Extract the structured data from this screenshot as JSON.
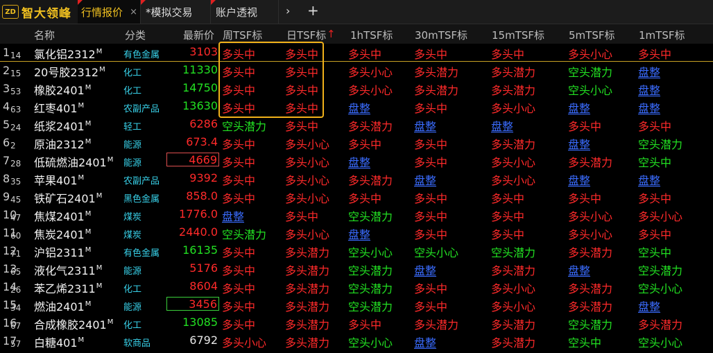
{
  "app": {
    "logo_mark": "ZD",
    "logo_text": "智大领峰"
  },
  "tabs": [
    {
      "label": "行情报价",
      "close": "×"
    },
    {
      "label": "*模拟交易"
    },
    {
      "label": "账户透视"
    }
  ],
  "tab_controls": {
    "arrow": "›",
    "plus": "+"
  },
  "columns": {
    "name": "名称",
    "category": "分类",
    "price": "最新价",
    "weekly": "周TSF标",
    "daily": "日TSF标",
    "sort_arrow": "↑",
    "h1": "1hTSF标",
    "m30": "30mTSF标",
    "m15": "15mTSF标",
    "m5": "5mTSF标",
    "m1": "1mTSF标"
  },
  "rows": [
    {
      "n": "1",
      "s": "14",
      "name": "氯化铝2312",
      "m": "M",
      "cat": "有色金属",
      "price": "3103",
      "pc": "red",
      "box": "",
      "sig": [
        "多头中",
        "多头中",
        "多头中",
        "多头中",
        "多头中",
        "多头小心",
        "多头中"
      ],
      "sc": [
        "red",
        "red",
        "red",
        "red",
        "red",
        "red",
        "red"
      ]
    },
    {
      "n": "2",
      "s": "15",
      "name": "20号胶2312",
      "m": "M",
      "cat": "化工",
      "price": "11330",
      "pc": "green",
      "box": "",
      "sig": [
        "多头中",
        "多头中",
        "多头小心",
        "多头潜力",
        "多头潜力",
        "空头潜力",
        "盘整"
      ],
      "sc": [
        "red",
        "red",
        "red",
        "red",
        "red",
        "green",
        "blue"
      ]
    },
    {
      "n": "3",
      "s": "53",
      "name": "橡胶2401",
      "m": "M",
      "cat": "化工",
      "price": "14750",
      "pc": "green",
      "box": "",
      "sig": [
        "多头中",
        "多头中",
        "多头小心",
        "多头潜力",
        "多头潜力",
        "空头小心",
        "盘整"
      ],
      "sc": [
        "red",
        "red",
        "red",
        "red",
        "red",
        "green",
        "blue"
      ]
    },
    {
      "n": "4",
      "s": "63",
      "name": "红枣401",
      "m": "M",
      "cat": "农副产品",
      "price": "13630",
      "pc": "green",
      "box": "",
      "sig": [
        "多头中",
        "多头中",
        "盘整",
        "多头中",
        "多头小心",
        "盘整",
        "盘整"
      ],
      "sc": [
        "red",
        "red",
        "blue",
        "red",
        "red",
        "blue",
        "blue"
      ]
    },
    {
      "n": "5",
      "s": "24",
      "name": "纸浆2401",
      "m": "M",
      "cat": "轻工",
      "price": "6286",
      "pc": "red",
      "box": "",
      "sig": [
        "空头潜力",
        "多头中",
        "多头潜力",
        "盘整",
        "盘整",
        "多头中",
        "多头中"
      ],
      "sc": [
        "green",
        "red",
        "red",
        "blue",
        "blue",
        "red",
        "red"
      ]
    },
    {
      "n": "6",
      "s": "2",
      "name": "原油2312",
      "m": "M",
      "cat": "能源",
      "price": "673.4",
      "pc": "red",
      "box": "",
      "sig": [
        "多头中",
        "多头小心",
        "多头中",
        "多头中",
        "多头潜力",
        "盘整",
        "空头潜力"
      ],
      "sc": [
        "red",
        "red",
        "red",
        "red",
        "red",
        "blue",
        "green"
      ]
    },
    {
      "n": "7",
      "s": "28",
      "name": "低硫燃油2401",
      "m": "M",
      "cat": "能源",
      "price": "4669",
      "pc": "red",
      "box": "red",
      "sig": [
        "多头中",
        "多头小心",
        "盘整",
        "多头中",
        "多头小心",
        "多头潜力",
        "空头中"
      ],
      "sc": [
        "red",
        "red",
        "blue",
        "red",
        "red",
        "red",
        "green"
      ]
    },
    {
      "n": "8",
      "s": "35",
      "name": "苹果401",
      "m": "M",
      "cat": "农副产品",
      "price": "9392",
      "pc": "red",
      "box": "",
      "sig": [
        "多头中",
        "多头小心",
        "多头潜力",
        "盘整",
        "多头小心",
        "盘整",
        "盘整"
      ],
      "sc": [
        "red",
        "red",
        "red",
        "blue",
        "red",
        "blue",
        "blue"
      ]
    },
    {
      "n": "9",
      "s": "45",
      "name": "铁矿石2401",
      "m": "M",
      "cat": "黑色金属",
      "price": "858.0",
      "pc": "red",
      "box": "",
      "sig": [
        "多头中",
        "多头小心",
        "多头中",
        "多头中",
        "多头中",
        "多头中",
        "多头中"
      ],
      "sc": [
        "red",
        "red",
        "red",
        "red",
        "red",
        "red",
        "red"
      ]
    },
    {
      "n": "10",
      "s": "47",
      "name": "焦煤2401",
      "m": "M",
      "cat": "煤炭",
      "price": "1776.0",
      "pc": "red",
      "box": "",
      "sig": [
        "盘整",
        "多头中",
        "空头潜力",
        "多头中",
        "多头中",
        "多头小心",
        "多头小心"
      ],
      "sc": [
        "blue",
        "red",
        "green",
        "red",
        "red",
        "red",
        "red"
      ]
    },
    {
      "n": "11",
      "s": "60",
      "name": "焦炭2401",
      "m": "M",
      "cat": "煤炭",
      "price": "2440.0",
      "pc": "red",
      "box": "",
      "sig": [
        "空头潜力",
        "多头小心",
        "盘整",
        "多头中",
        "多头中",
        "多头小心",
        "多头中"
      ],
      "sc": [
        "green",
        "red",
        "blue",
        "red",
        "red",
        "red",
        "red"
      ]
    },
    {
      "n": "12",
      "s": "71",
      "name": "沪铝2311",
      "m": "M",
      "cat": "有色金属",
      "price": "16135",
      "pc": "green",
      "box": "",
      "sig": [
        "多头中",
        "多头潜力",
        "空头小心",
        "空头小心",
        "空头潜力",
        "多头潜力",
        "空头中"
      ],
      "sc": [
        "red",
        "red",
        "green",
        "green",
        "green",
        "red",
        "green"
      ]
    },
    {
      "n": "13",
      "s": "65",
      "name": "液化气2311",
      "m": "M",
      "cat": "能源",
      "price": "5176",
      "pc": "red",
      "box": "",
      "sig": [
        "多头中",
        "多头潜力",
        "空头潜力",
        "盘整",
        "多头潜力",
        "盘整",
        "空头潜力"
      ],
      "sc": [
        "red",
        "red",
        "green",
        "blue",
        "red",
        "blue",
        "green"
      ]
    },
    {
      "n": "14",
      "s": "26",
      "name": "苯乙烯2311",
      "m": "M",
      "cat": "化工",
      "price": "8604",
      "pc": "red",
      "box": "",
      "sig": [
        "多头中",
        "多头潜力",
        "空头潜力",
        "多头中",
        "多头小心",
        "多头潜力",
        "空头小心"
      ],
      "sc": [
        "red",
        "red",
        "green",
        "red",
        "red",
        "red",
        "green"
      ]
    },
    {
      "n": "15",
      "s": "34",
      "name": "燃油2401",
      "m": "M",
      "cat": "能源",
      "price": "3456",
      "pc": "red",
      "box": "green",
      "sig": [
        "多头中",
        "多头潜力",
        "空头潜力",
        "多头中",
        "多头小心",
        "多头潜力",
        "盘整"
      ],
      "sc": [
        "red",
        "red",
        "green",
        "red",
        "red",
        "red",
        "blue"
      ]
    },
    {
      "n": "16",
      "s": "67",
      "name": "合成橡胶2401",
      "m": "M",
      "cat": "化工",
      "price": "13085",
      "pc": "green",
      "box": "",
      "sig": [
        "多头中",
        "多头潜力",
        "多头中",
        "多头潜力",
        "多头潜力",
        "空头潜力",
        "多头潜力"
      ],
      "sc": [
        "red",
        "red",
        "red",
        "red",
        "red",
        "green",
        "red"
      ]
    },
    {
      "n": "17",
      "s": "57",
      "name": "白糖401",
      "m": "M",
      "cat": "软商品",
      "price": "6792",
      "pc": "white",
      "box": "",
      "sig": [
        "多头小心",
        "多头潜力",
        "空头小心",
        "盘整",
        "多头潜力",
        "空头中",
        "空头小心"
      ],
      "sc": [
        "red",
        "red",
        "green",
        "blue",
        "red",
        "green",
        "green"
      ]
    }
  ]
}
